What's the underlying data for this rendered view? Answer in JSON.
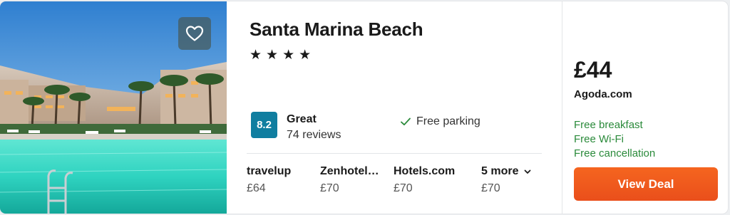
{
  "hotel": {
    "name": "Santa Marina Beach",
    "stars": 4,
    "star_glyph": "★",
    "score": "8.2",
    "rating_word": "Great",
    "reviews": "74 reviews",
    "amenity": "Free parking",
    "favorite_icon": "heart-icon"
  },
  "providers": [
    {
      "name": "travelup",
      "price": "£64"
    },
    {
      "name": "Zenhotel…",
      "price": "£70"
    },
    {
      "name": "Hotels.com",
      "price": "£70"
    }
  ],
  "more": {
    "label": "5 more",
    "price": "£70"
  },
  "deal": {
    "price": "£44",
    "site": "Agoda.com",
    "perks": [
      "Free breakfast",
      "Free Wi-Fi",
      "Free cancellation"
    ],
    "button_label": "View Deal"
  },
  "colors": {
    "score_bg": "#107ea0",
    "perk_green": "#2a8a3a",
    "button_orange": "#f25c1e"
  }
}
